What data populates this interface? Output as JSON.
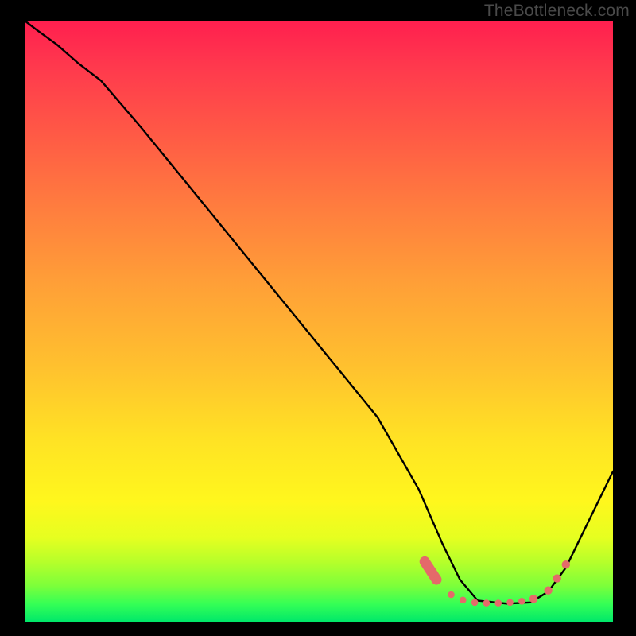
{
  "watermark": "TheBottleneck.com",
  "colors": {
    "page_bg": "#000000",
    "curve": "#000000",
    "marker": "#e46a6a",
    "gradient_top": "#ff1f4f",
    "gradient_bottom": "#00e86a"
  },
  "chart_data": {
    "type": "line",
    "title": "",
    "xlabel": "",
    "ylabel": "",
    "xlim": [
      0,
      100
    ],
    "ylim": [
      0,
      100
    ],
    "grid": false,
    "legend": false,
    "notes": "V-shaped curve on a vertical red-to-green gradient. No axis ticks, no labels, no legend. Minimum sits around x≈80. A cluster of salmon markers lies along the trough and slightly up the right arm. Values below are read from pixel positions (0–100 normalized).",
    "series": [
      {
        "name": "curve",
        "kind": "line",
        "x": [
          0.0,
          2.0,
          5.5,
          9.0,
          13.0,
          20.0,
          30.0,
          40.0,
          50.0,
          60.0,
          67.0,
          71.0,
          74.0,
          77.0,
          82.0,
          86.0,
          89.0,
          92.0,
          94.0,
          96.5,
          100.0
        ],
        "y": [
          100.0,
          98.5,
          96.0,
          93.0,
          90.0,
          82.0,
          70.0,
          58.0,
          46.0,
          34.0,
          22.0,
          13.0,
          7.0,
          3.5,
          3.0,
          3.2,
          5.0,
          9.0,
          13.0,
          18.0,
          25.0
        ]
      },
      {
        "name": "markers",
        "kind": "scatter",
        "x": [
          68.0,
          70.0,
          72.5,
          74.5,
          76.5,
          78.5,
          80.5,
          82.5,
          84.5,
          86.5,
          89.0,
          90.5,
          92.0
        ],
        "y": [
          10.0,
          7.0,
          4.5,
          3.6,
          3.2,
          3.1,
          3.1,
          3.2,
          3.4,
          3.8,
          5.2,
          7.2,
          9.5
        ]
      }
    ]
  }
}
